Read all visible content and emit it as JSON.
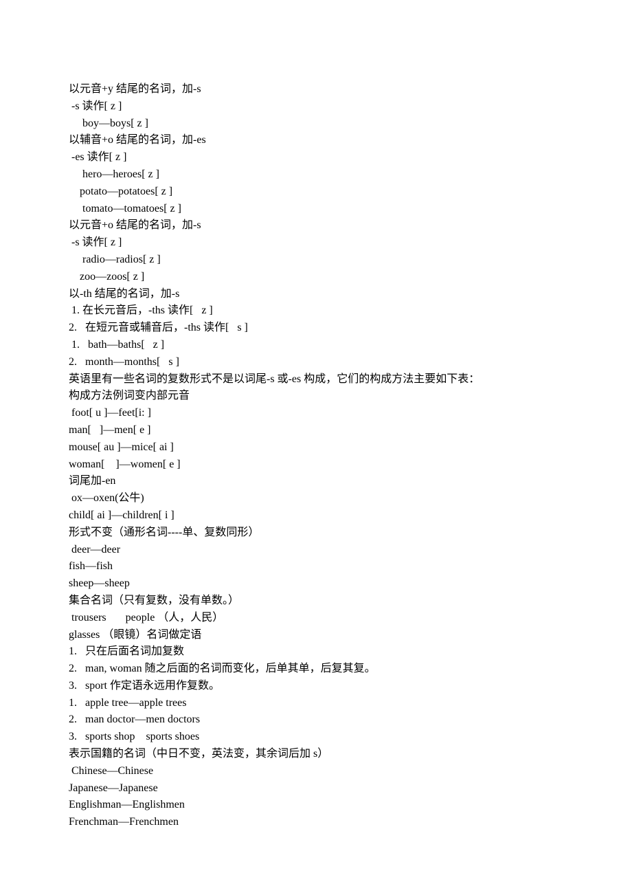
{
  "lines": [
    "以元音+y 结尾的名词，加-s",
    " -s 读作[ z ]",
    "     boy—boys[ z ]",
    "以辅音+o 结尾的名词，加-es",
    " -es 读作[ z ]",
    "     hero—heroes[ z ]",
    "    potato—potatoes[ z ]",
    "     tomato—tomatoes[ z ]",
    "以元音+o 结尾的名词，加-s",
    " -s 读作[ z ]",
    "     radio—radios[ z ]",
    "    zoo—zoos[ z ]",
    "以-th 结尾的名词，加-s",
    " 1. 在长元音后，-ths 读作[   z ]",
    "2.   在短元音或辅音后，-ths 读作[   s ]",
    " 1.   bath—baths[   z ]",
    "2.   month—months[   s ]",
    "英语里有一些名词的复数形式不是以词尾-s 或-es 构成，它们的构成方法主要如下表：",
    "构成方法例词变内部元音",
    " foot[ u ]—feet[i: ]",
    "man[   ]—men[ e ]",
    "mouse[ au ]—mice[ ai ]",
    "woman[    ]—women[ e ]",
    "词尾加-en",
    " ox—oxen(公牛)",
    "child[ ai ]—children[ i ]",
    "形式不变（通形名词----单、复数同形）",
    " deer—deer",
    "fish—fish",
    "sheep—sheep",
    "集合名词（只有复数，没有单数。）",
    " trousers       people （人，人民）",
    "glasses （眼镜）名词做定语",
    "1.   只在后面名词加复数",
    "2.   man, woman 随之后面的名词而变化，后单其单，后复其复。",
    "3.   sport 作定语永远用作复数。",
    "1.   apple tree—apple trees",
    "2.   man doctor—men doctors",
    "3.   sports shop    sports shoes",
    "表示国籍的名词（中日不变，英法变，其余词后加 s）",
    " Chinese—Chinese",
    "Japanese—Japanese",
    "Englishman—Englishmen",
    "Frenchman—Frenchmen"
  ]
}
